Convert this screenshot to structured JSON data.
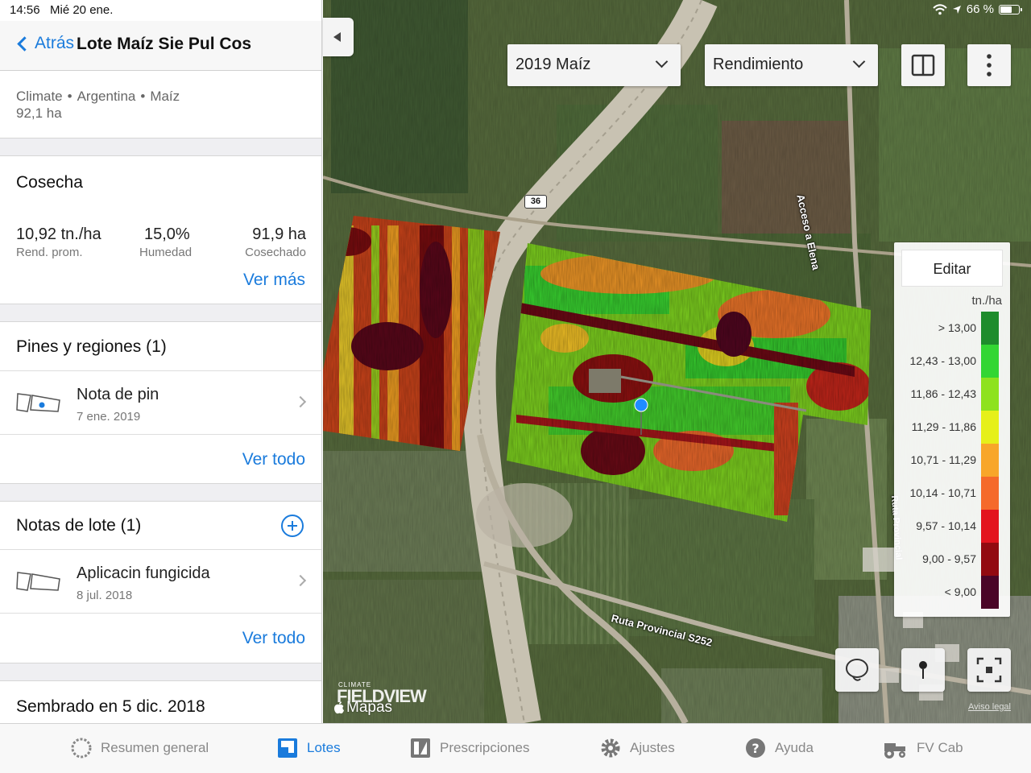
{
  "status_bar": {
    "time": "14:56",
    "date": "Mié 20 ene.",
    "battery": "66 %",
    "battery_level": 0.66
  },
  "nav": {
    "back_label": "Atrás",
    "title": "Lote Maíz Sie Pul Cos"
  },
  "field_meta": {
    "org": "Climate",
    "country": "Argentina",
    "crop": "Maíz",
    "separator": "•",
    "area": "92,1 ha"
  },
  "harvest": {
    "title": "Cosecha",
    "stats": [
      {
        "value": "10,92 tn./ha",
        "label": "Rend. prom."
      },
      {
        "value": "15,0%",
        "label": "Humedad"
      },
      {
        "value": "91,9 ha",
        "label": "Cosechado"
      }
    ],
    "more_link": "Ver más"
  },
  "pins": {
    "title": "Pines y regiones (1)",
    "items": [
      {
        "title": "Nota de pin",
        "date": "7 ene. 2019"
      }
    ],
    "see_all": "Ver todo"
  },
  "notes": {
    "title": "Notas de lote (1)",
    "items": [
      {
        "title": "Aplicacin fungicida",
        "date": "8 jul. 2018"
      }
    ],
    "see_all": "Ver todo"
  },
  "planted": {
    "title": "Sembrado en 5 dic. 2018"
  },
  "map": {
    "season_select": "2019 Maíz",
    "layer_select": "Rendimiento",
    "legend": {
      "edit_label": "Editar",
      "unit": "tn./ha",
      "ranges": [
        {
          "label": "> 13,00",
          "color": "#1e8c2c"
        },
        {
          "label": "12,43 - 13,00",
          "color": "#33d633"
        },
        {
          "label": "11,86 - 12,43",
          "color": "#8ee21e"
        },
        {
          "label": "11,29 - 11,86",
          "color": "#e6f01a"
        },
        {
          "label": "10,71 - 11,29",
          "color": "#f8a62a"
        },
        {
          "label": "10,14 - 10,71",
          "color": "#f56a2b"
        },
        {
          "label": "9,57 - 10,14",
          "color": "#e3141e"
        },
        {
          "label": "9,00 - 9,57",
          "color": "#920a10"
        },
        {
          "label": "< 9,00",
          "color": "#4a0527"
        }
      ]
    },
    "labels": {
      "route_36": "36",
      "acceso": "Acceso a Elena",
      "ruta_s252": "Ruta Provincial S252",
      "ruta_side": "Ruta Provincial"
    },
    "brand_top": "CLIMATE",
    "brand": "FIELDVIEW",
    "maps_credit": "Mapas",
    "legal": "Aviso legal"
  },
  "tabs": [
    {
      "label": "Resumen general",
      "active": false
    },
    {
      "label": "Lotes",
      "active": true
    },
    {
      "label": "Prescripciones",
      "active": false
    },
    {
      "label": "Ajustes",
      "active": false
    },
    {
      "label": "Ayuda",
      "active": false
    },
    {
      "label": "FV Cab",
      "active": false
    }
  ],
  "colors": {
    "accent": "#1a7bdc"
  }
}
